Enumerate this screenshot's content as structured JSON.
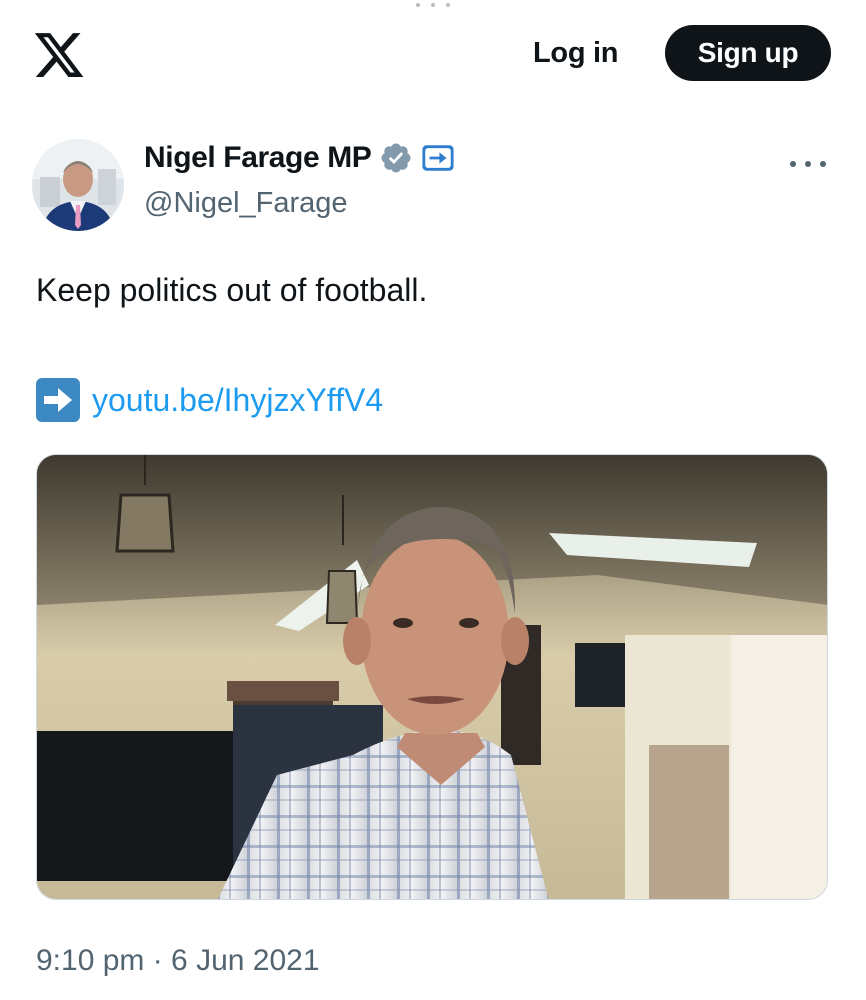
{
  "header": {
    "logo_icon": "x-logo-icon",
    "login_label": "Log in",
    "signup_label": "Sign up"
  },
  "tweet": {
    "author": {
      "display_name": "Nigel Farage MP",
      "handle": "@Nigel_Farage",
      "verified_icon": "verified-badge-icon",
      "affiliation_icon": "affiliation-badge-icon"
    },
    "more_icon": "more-options-icon",
    "text": "Keep politics out of football.",
    "link": {
      "icon": "arrow-right-icon",
      "text": "youtu.be/IhyjzxYffV4"
    },
    "media": {
      "type": "video-thumbnail"
    },
    "timestamp": "9:10 pm · 6 Jun 2021"
  },
  "colors": {
    "text": "#0f1419",
    "secondary": "#536471",
    "link": "#1d9bf0",
    "verified": "#829aab",
    "button_dark": "#0f1419"
  }
}
